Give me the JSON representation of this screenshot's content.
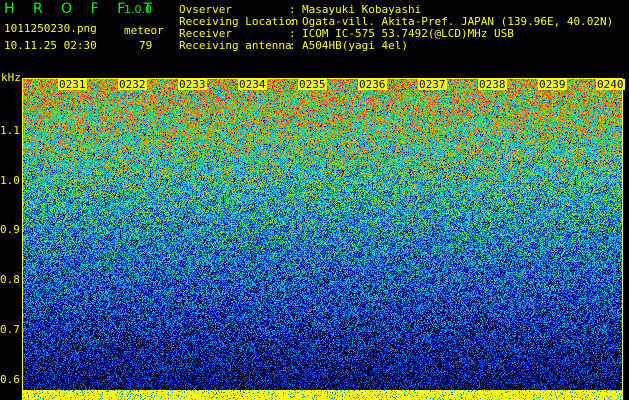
{
  "app": {
    "title": "H R O F F T",
    "version": "1.0.0"
  },
  "file": {
    "name": "1011250230.png",
    "datetime": "10.11.25 02:30"
  },
  "meteor": {
    "label": "meteor",
    "count": "79"
  },
  "info": [
    {
      "key": "Ovserver",
      "value": "Masayuki Kobayashi"
    },
    {
      "key": "Receiving Location",
      "value": "Ogata-vill. Akita-Pref. JAPAN (139.96E, 40.02N)"
    },
    {
      "key": "Receiver",
      "value": "ICOM IC-575 53.7492(@LCD)MHz USB"
    },
    {
      "key": "Receiving antenna",
      "value": "A504HB(yagi 4el)"
    }
  ],
  "axis": {
    "y_unit": "kHz",
    "y_ticks": [
      "1.1",
      "1.0",
      "0.9",
      "0.8",
      "0.7",
      "0.6"
    ],
    "x_ticks": [
      "0231",
      "0232",
      "0233",
      "0234",
      "0235",
      "0236",
      "0237",
      "0238",
      "0239",
      "0240"
    ]
  },
  "colors": {
    "text": "#ffff00",
    "title": "#00ff00",
    "background": "#000000"
  }
}
